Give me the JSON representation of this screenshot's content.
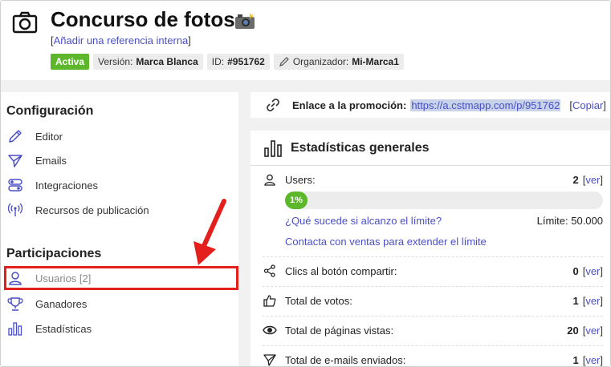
{
  "header": {
    "title": "Concurso de fotos",
    "title_emoji": "📸",
    "add_reference": "Añadir una referencia interna",
    "badges": {
      "status": "Activa",
      "version_label": "Versión:",
      "version_value": "Marca Blanca",
      "id_label": "ID:",
      "id_value": "#951762",
      "organizer_label": "Organizador:",
      "organizer_value": "Mi-Marca1"
    }
  },
  "sidebar": {
    "config_title": "Configuración",
    "config_items": [
      {
        "label": "Editor",
        "icon": "pencil-icon"
      },
      {
        "label": "Emails",
        "icon": "send-icon"
      },
      {
        "label": "Integraciones",
        "icon": "toggles-icon"
      },
      {
        "label": "Recursos de publicación",
        "icon": "broadcast-icon"
      }
    ],
    "participations_title": "Participaciones",
    "participation_items": [
      {
        "label": "Usuarios [2]",
        "icon": "user-icon",
        "selected": true
      },
      {
        "label": "Ganadores",
        "icon": "trophy-icon"
      },
      {
        "label": "Estadísticas",
        "icon": "bar-chart-icon"
      }
    ]
  },
  "link": {
    "label": "Enlace a la promoción:",
    "url": "https://a.cstmapp.com/p/951762",
    "copy": "Copiar"
  },
  "stats": {
    "title": "Estadísticas generales",
    "users": {
      "label": "Users:",
      "value": "2",
      "ver": "ver"
    },
    "progress": {
      "label": "1%",
      "percent": 1
    },
    "limit_question": "¿Qué sucede si alcanzo el límite?",
    "limit_text": "Límite: 50.000",
    "contact_sales": "Contacta con ventas para extender el límite",
    "rows": [
      {
        "label": "Clics al botón compartir:",
        "value": "0",
        "ver": "ver",
        "icon": "share-icon"
      },
      {
        "label": "Total de votos:",
        "value": "1",
        "ver": "ver",
        "icon": "thumbs-up-icon"
      },
      {
        "label": "Total de páginas vistas:",
        "value": "20",
        "ver": "ver",
        "icon": "eye-icon"
      },
      {
        "label": "Total de e-mails enviados:",
        "value": "1",
        "ver": "ver",
        "icon": "send-icon"
      }
    ]
  },
  "colors": {
    "accent": "#4a4fc7",
    "active_green": "#5cb82a",
    "highlight_red": "#e4201c"
  }
}
